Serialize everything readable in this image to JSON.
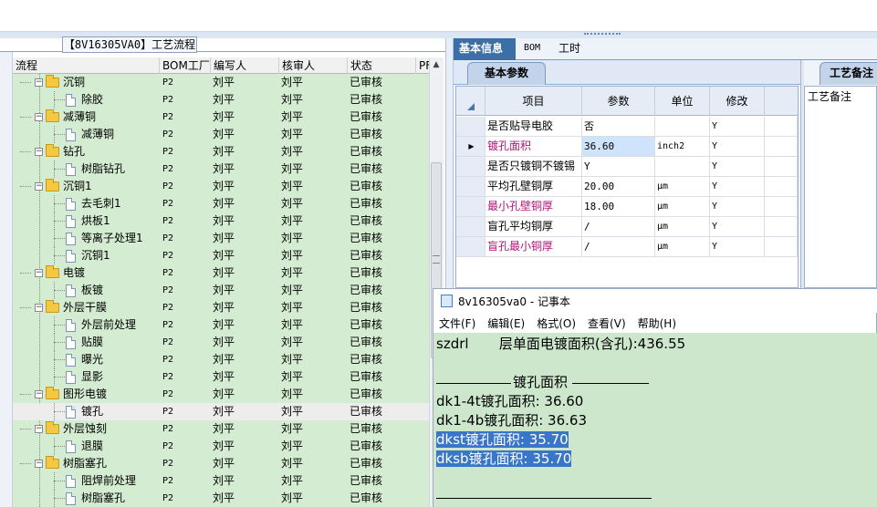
{
  "left_panel": {
    "title": "【8V16305VA0】工艺流程",
    "columns": [
      "流程",
      "BOM工厂",
      "编写人",
      "核审人",
      "状态",
      "PF"
    ],
    "rows": [
      {
        "level": 1,
        "type": "folder",
        "name": "沉铜",
        "bom": "P2",
        "writer": "刘平",
        "reviewer": "刘平",
        "status": "已审核"
      },
      {
        "level": 2,
        "type": "doc",
        "name": "除胶",
        "bom": "P2",
        "writer": "刘平",
        "reviewer": "刘平",
        "status": "已审核"
      },
      {
        "level": 1,
        "type": "folder",
        "name": "减薄铜",
        "bom": "P2",
        "writer": "刘平",
        "reviewer": "刘平",
        "status": "已审核"
      },
      {
        "level": 2,
        "type": "doc",
        "name": "减薄铜",
        "bom": "P2",
        "writer": "刘平",
        "reviewer": "刘平",
        "status": "已审核"
      },
      {
        "level": 1,
        "type": "folder",
        "name": "钻孔",
        "bom": "P2",
        "writer": "刘平",
        "reviewer": "刘平",
        "status": "已审核"
      },
      {
        "level": 2,
        "type": "doc",
        "name": "树脂钻孔",
        "bom": "P2",
        "writer": "刘平",
        "reviewer": "刘平",
        "status": "已审核"
      },
      {
        "level": 1,
        "type": "folder",
        "name": "沉铜1",
        "bom": "P2",
        "writer": "刘平",
        "reviewer": "刘平",
        "status": "已审核"
      },
      {
        "level": 2,
        "type": "doc",
        "name": "去毛刺1",
        "bom": "P2",
        "writer": "刘平",
        "reviewer": "刘平",
        "status": "已审核"
      },
      {
        "level": 2,
        "type": "doc",
        "name": "烘板1",
        "bom": "P2",
        "writer": "刘平",
        "reviewer": "刘平",
        "status": "已审核"
      },
      {
        "level": 2,
        "type": "doc",
        "name": "等离子处理1",
        "bom": "P2",
        "writer": "刘平",
        "reviewer": "刘平",
        "status": "已审核"
      },
      {
        "level": 2,
        "type": "doc",
        "name": "沉铜1",
        "bom": "P2",
        "writer": "刘平",
        "reviewer": "刘平",
        "status": "已审核"
      },
      {
        "level": 1,
        "type": "folder",
        "name": "电镀",
        "bom": "P2",
        "writer": "刘平",
        "reviewer": "刘平",
        "status": "已审核"
      },
      {
        "level": 2,
        "type": "doc",
        "name": "板镀",
        "bom": "P2",
        "writer": "刘平",
        "reviewer": "刘平",
        "status": "已审核"
      },
      {
        "level": 1,
        "type": "folder",
        "name": "外层干膜",
        "bom": "P2",
        "writer": "刘平",
        "reviewer": "刘平",
        "status": "已审核"
      },
      {
        "level": 2,
        "type": "doc",
        "name": "外层前处理",
        "bom": "P2",
        "writer": "刘平",
        "reviewer": "刘平",
        "status": "已审核"
      },
      {
        "level": 2,
        "type": "doc",
        "name": "贴膜",
        "bom": "P2",
        "writer": "刘平",
        "reviewer": "刘平",
        "status": "已审核"
      },
      {
        "level": 2,
        "type": "doc",
        "name": "曝光",
        "bom": "P2",
        "writer": "刘平",
        "reviewer": "刘平",
        "status": "已审核"
      },
      {
        "level": 2,
        "type": "doc",
        "name": "显影",
        "bom": "P2",
        "writer": "刘平",
        "reviewer": "刘平",
        "status": "已审核"
      },
      {
        "level": 1,
        "type": "folder",
        "name": "图形电镀",
        "bom": "P2",
        "writer": "刘平",
        "reviewer": "刘平",
        "status": "已审核"
      },
      {
        "level": 2,
        "type": "doc",
        "name": "镀孔",
        "bom": "P2",
        "writer": "刘平",
        "reviewer": "刘平",
        "status": "已审核",
        "selected": true
      },
      {
        "level": 1,
        "type": "folder",
        "name": "外层蚀刻",
        "bom": "P2",
        "writer": "刘平",
        "reviewer": "刘平",
        "status": "已审核"
      },
      {
        "level": 2,
        "type": "doc",
        "name": "退膜",
        "bom": "P2",
        "writer": "刘平",
        "reviewer": "刘平",
        "status": "已审核"
      },
      {
        "level": 1,
        "type": "folder",
        "name": "树脂塞孔",
        "bom": "P2",
        "writer": "刘平",
        "reviewer": "刘平",
        "status": "已审核"
      },
      {
        "level": 2,
        "type": "doc",
        "name": "阻焊前处理",
        "bom": "P2",
        "writer": "刘平",
        "reviewer": "刘平",
        "status": "已审核"
      },
      {
        "level": 2,
        "type": "doc",
        "name": "树脂塞孔",
        "bom": "P2",
        "writer": "刘平",
        "reviewer": "刘平",
        "status": "已审核"
      }
    ]
  },
  "right_panel": {
    "tabs": [
      "基本信息",
      "BOM",
      "工时"
    ],
    "subtab": "基本参数",
    "notes_tab": "工艺备注",
    "notes_label": "工艺备注",
    "grid_headers": [
      "项目",
      "参数",
      "单位",
      "修改"
    ],
    "grid_rows": [
      {
        "item": "是否贴导电胶",
        "param": "否",
        "unit": "",
        "mod": "Y",
        "pink": false,
        "current": false
      },
      {
        "item": "镀孔面积",
        "param": "36.60",
        "unit": "inch2",
        "mod": "Y",
        "pink": true,
        "current": true
      },
      {
        "item": "是否只镀铜不镀锡",
        "param": "Y",
        "unit": "",
        "mod": "Y",
        "pink": false,
        "current": false
      },
      {
        "item": "平均孔壁铜厚",
        "param": "20.00",
        "unit": "μm",
        "mod": "Y",
        "pink": false,
        "current": false
      },
      {
        "item": "最小孔壁铜厚",
        "param": "18.00",
        "unit": "μm",
        "mod": "Y",
        "pink": true,
        "current": false
      },
      {
        "item": "盲孔平均铜厚",
        "param": "/",
        "unit": "μm",
        "mod": "Y",
        "pink": false,
        "current": false
      },
      {
        "item": "盲孔最小铜厚",
        "param": "/",
        "unit": "μm",
        "mod": "Y",
        "pink": true,
        "current": false
      }
    ]
  },
  "notepad": {
    "title": "8v16305va0 - 记事本",
    "menu": [
      "文件(F)",
      "编辑(E)",
      "格式(O)",
      "查看(V)",
      "帮助(H)"
    ],
    "lines": [
      {
        "text": "szdrl       层单面电镀面积(含孔):436.55",
        "highlight": false
      },
      {
        "text": "",
        "highlight": false
      },
      {
        "text": "镀孔面积",
        "highlight": false,
        "section_title": true
      },
      {
        "text": "dk1-4t镀孔面积: 36.60",
        "highlight": false
      },
      {
        "text": "dk1-4b镀孔面积: 36.63",
        "highlight": false
      },
      {
        "text": "dkst镀孔面积: 35.70",
        "highlight": true
      },
      {
        "text": "dksb镀孔面积: 35.70",
        "highlight": true
      }
    ]
  },
  "colors": {
    "tree_bg": "#d4ecd1",
    "notepad_bg": "#cde7cd",
    "tab_active": "#3c6ea8",
    "pink_text": "#b0147a",
    "highlight": "#3a76c8"
  }
}
